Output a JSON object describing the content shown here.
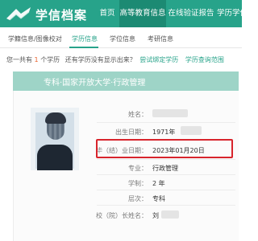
{
  "header": {
    "site_title": "学信档案",
    "nav": [
      "首页",
      "高等教育信息",
      "在线验证报告",
      "学历学位"
    ]
  },
  "tabs": [
    "学籍信息/图像校对",
    "学历信息",
    "学位信息",
    "考研信息"
  ],
  "summary": {
    "prefix": "您一共有",
    "count": "1",
    "middle": "个学历",
    "question": "还有学历没有显示出来？",
    "link1": "尝试绑定学历",
    "link2": "学历查询范围"
  },
  "record": {
    "banner": "专科·国家开放大学·行政管理",
    "fields": [
      {
        "label": "姓名：",
        "value": ""
      },
      {
        "label": "出生日期：",
        "value": "1971年"
      },
      {
        "label": "毕（结）业日期：",
        "value": "2023年01月20日"
      },
      {
        "label": "专业：",
        "value": "行政管理"
      },
      {
        "label": "学制：",
        "value": "2 年"
      },
      {
        "label": "层次：",
        "value": "专科"
      },
      {
        "label": "校（院）长姓名：",
        "value": "刘"
      }
    ]
  },
  "colors": {
    "brand_green": "#27a38a",
    "highlight_red": "#d8242c",
    "accent_orange": "#e8612c"
  }
}
